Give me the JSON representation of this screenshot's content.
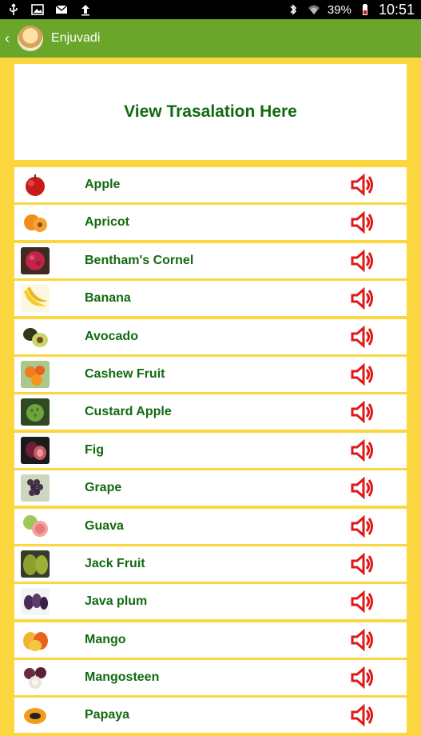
{
  "statusbar": {
    "icons_left": [
      "usb-icon",
      "image-icon",
      "mail-icon",
      "upload-icon"
    ],
    "icons_right": [
      "bluetooth-icon",
      "wifi-icon",
      "battery-icon"
    ],
    "battery": "39%",
    "time": "10:51"
  },
  "appbar": {
    "title": "Enjuvadi"
  },
  "translation": {
    "text": "View Trasalation Here"
  },
  "items": [
    {
      "label": "Apple",
      "icon": "apple-icon",
      "color": "#d41e1e"
    },
    {
      "label": "Apricot",
      "icon": "apricot-icon",
      "color": "#f28b1a"
    },
    {
      "label": "Bentham's Cornel",
      "icon": "benthams-cornel-icon",
      "color": "#c2234a"
    },
    {
      "label": "Banana",
      "icon": "banana-icon",
      "color": "#f3cf2a"
    },
    {
      "label": "Avocado",
      "icon": "avocado-icon",
      "color": "#6c8a2b"
    },
    {
      "label": "Cashew Fruit",
      "icon": "cashew-fruit-icon",
      "color": "#f57a1b"
    },
    {
      "label": "Custard Apple",
      "icon": "custard-apple-icon",
      "color": "#6fa33d"
    },
    {
      "label": "Fig",
      "icon": "fig-icon",
      "color": "#8b2a3c"
    },
    {
      "label": "Grape",
      "icon": "grape-icon",
      "color": "#45334a"
    },
    {
      "label": "Guava",
      "icon": "guava-icon",
      "color": "#9cc85a"
    },
    {
      "label": "Jack Fruit",
      "icon": "jack-fruit-icon",
      "color": "#9bb037"
    },
    {
      "label": "Java plum",
      "icon": "java-plum-icon",
      "color": "#4b2a5a"
    },
    {
      "label": "Mango",
      "icon": "mango-icon",
      "color": "#f2b233"
    },
    {
      "label": "Mangosteen",
      "icon": "mangosteen-icon",
      "color": "#6a2a45"
    },
    {
      "label": "Papaya",
      "icon": "papaya-icon",
      "color": "#f39b1b"
    }
  ],
  "colors": {
    "appbar": "#6aa629",
    "background": "#fbd63f",
    "text": "#116a11",
    "speaker": "#e01818"
  }
}
